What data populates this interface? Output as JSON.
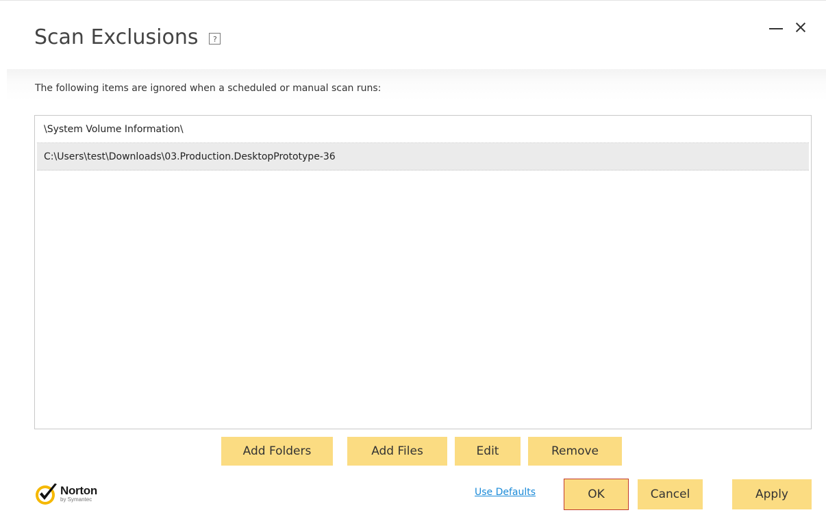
{
  "window": {
    "title": "Scan Exclusions",
    "help_label": "?"
  },
  "description": "The following items are ignored when a scheduled or manual scan runs:",
  "exclusions": [
    {
      "path": "\\System Volume Information\\"
    },
    {
      "path": "C:\\Users\\test\\Downloads\\03.Production.DesktopPrototype-36"
    }
  ],
  "actions": {
    "add_folders": "Add Folders",
    "add_files": "Add Files",
    "edit": "Edit",
    "remove": "Remove"
  },
  "footer": {
    "logo_name": "Norton",
    "logo_sub": "by Symantec",
    "use_defaults": "Use Defaults",
    "ok": "OK",
    "cancel": "Cancel",
    "apply": "Apply"
  },
  "colors": {
    "button_bg": "#fbdc82",
    "link": "#1a8ad8",
    "focus_border": "#c0392b",
    "logo_check": "#f5b800"
  }
}
